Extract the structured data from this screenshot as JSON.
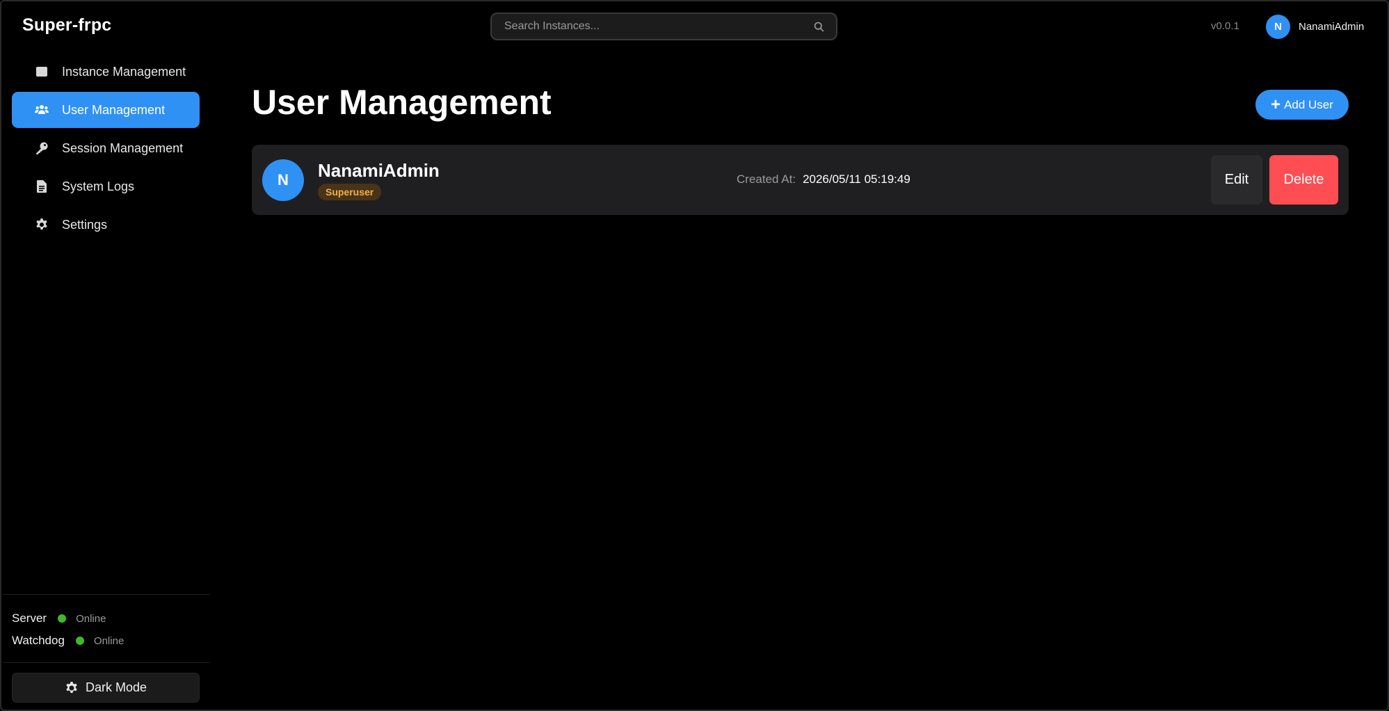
{
  "app": {
    "brand": "Super-frpc"
  },
  "header": {
    "search_placeholder": "Search Instances...",
    "version": "v0.0.1",
    "user": {
      "initial": "N",
      "name": "NanamiAdmin"
    }
  },
  "sidebar": {
    "items": [
      {
        "label": "Instance Management",
        "icon": "database-icon",
        "active": false
      },
      {
        "label": "User Management",
        "icon": "users-icon",
        "active": true
      },
      {
        "label": "Session Management",
        "icon": "key-icon",
        "active": false
      },
      {
        "label": "System Logs",
        "icon": "file-text-icon",
        "active": false
      },
      {
        "label": "Settings",
        "icon": "gear-icon",
        "active": false
      }
    ],
    "status": [
      {
        "label": "Server",
        "value": "Online",
        "color": "#41b82a"
      },
      {
        "label": "Watchdog",
        "value": "Online",
        "color": "#41b82a"
      }
    ],
    "dark_mode_label": "Dark Mode"
  },
  "main": {
    "title": "User Management",
    "add_user_label": "Add User",
    "users": [
      {
        "initial": "N",
        "name": "NanamiAdmin",
        "role": "Superuser",
        "created_label": "Created At:",
        "created_value": "2026/05/11 05:19:49",
        "edit_label": "Edit",
        "delete_label": "Delete"
      }
    ]
  },
  "colors": {
    "accent": "#2f91f4",
    "danger": "#ff4d54",
    "badge_text": "#f2b04b",
    "online": "#41b82a"
  }
}
